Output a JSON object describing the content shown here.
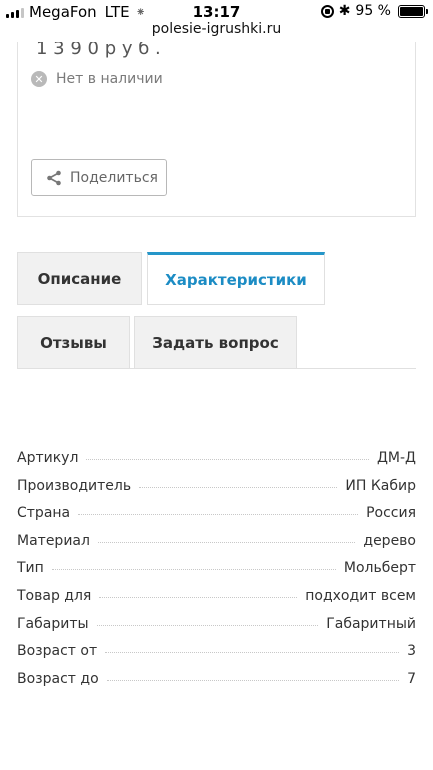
{
  "status_bar": {
    "carrier": "MegaFon",
    "network": "LTE",
    "time": "13:17",
    "battery": "95 %",
    "url": "polesie-igrushki.ru"
  },
  "product": {
    "price_cut": "1 3 9 0 р у б .",
    "availability": "Нет в наличии",
    "share_label": "Поделиться"
  },
  "tabs": [
    {
      "label": "Описание",
      "active": false
    },
    {
      "label": "Характеристики",
      "active": true
    },
    {
      "label": "Отзывы",
      "active": false
    },
    {
      "label": "Задать вопрос",
      "active": false
    }
  ],
  "specs": [
    {
      "key": "Артикул",
      "value": "ДМ-Д"
    },
    {
      "key": "Производитель",
      "value": "ИП Кабир"
    },
    {
      "key": "Страна",
      "value": "Россия"
    },
    {
      "key": "Материал",
      "value": "дерево"
    },
    {
      "key": "Тип",
      "value": "Мольберт"
    },
    {
      "key": "Товар для",
      "value": "подходит всем"
    },
    {
      "key": "Габариты",
      "value": "Габаритный"
    },
    {
      "key": "Возраст от",
      "value": "3"
    },
    {
      "key": "Возраст до",
      "value": "7"
    }
  ],
  "colors": {
    "accent": "#1c8cc4",
    "tab_bg": "#f1f1f1",
    "border": "#e0e0e0"
  }
}
